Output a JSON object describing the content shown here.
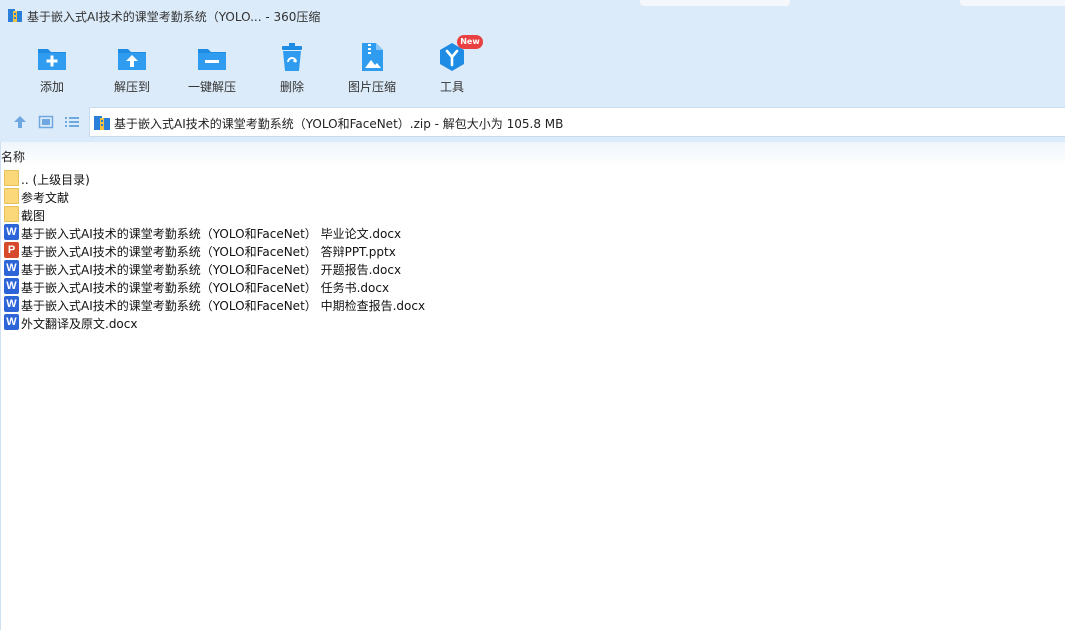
{
  "window": {
    "title": "基于嵌入式AI技术的课堂考勤系统（YOLO... - 360压缩"
  },
  "toolbar": {
    "items": [
      {
        "label": "添加",
        "icon": "add-icon"
      },
      {
        "label": "解压到",
        "icon": "extract-to-icon"
      },
      {
        "label": "一键解压",
        "icon": "one-click-extract-icon"
      },
      {
        "label": "删除",
        "icon": "delete-icon"
      },
      {
        "label": "图片压缩",
        "icon": "image-compress-icon"
      },
      {
        "label": "工具",
        "icon": "tools-icon",
        "badge": "New"
      }
    ]
  },
  "address": {
    "text": "基于嵌入式AI技术的课堂考勤系统（YOLO和FaceNet）.zip - 解包大小为 105.8 MB"
  },
  "list": {
    "column_name": "名称",
    "files": [
      {
        "name": ".. (上级目录)",
        "type": "folder"
      },
      {
        "name": "参考文献",
        "type": "folder"
      },
      {
        "name": "截图",
        "type": "folder"
      },
      {
        "name": "基于嵌入式AI技术的课堂考勤系统（YOLO和FaceNet） 毕业论文.docx",
        "type": "word",
        "glyph": "W"
      },
      {
        "name": "基于嵌入式AI技术的课堂考勤系统（YOLO和FaceNet） 答辩PPT.pptx",
        "type": "ppt",
        "glyph": "P"
      },
      {
        "name": "基于嵌入式AI技术的课堂考勤系统（YOLO和FaceNet） 开题报告.docx",
        "type": "word",
        "glyph": "W"
      },
      {
        "name": "基于嵌入式AI技术的课堂考勤系统（YOLO和FaceNet） 任务书.docx",
        "type": "word",
        "glyph": "W"
      },
      {
        "name": "基于嵌入式AI技术的课堂考勤系统（YOLO和FaceNet） 中期检查报告.docx",
        "type": "word",
        "glyph": "W"
      },
      {
        "name": "外文翻译及原文.docx",
        "type": "word",
        "glyph": "W"
      }
    ]
  },
  "colors": {
    "chrome": "#dcebf9",
    "icon_blue": "#1e8be4",
    "word": "#2d64d8",
    "ppt": "#d64a2b",
    "folder": "#fbd97a",
    "badge": "#e94141"
  }
}
